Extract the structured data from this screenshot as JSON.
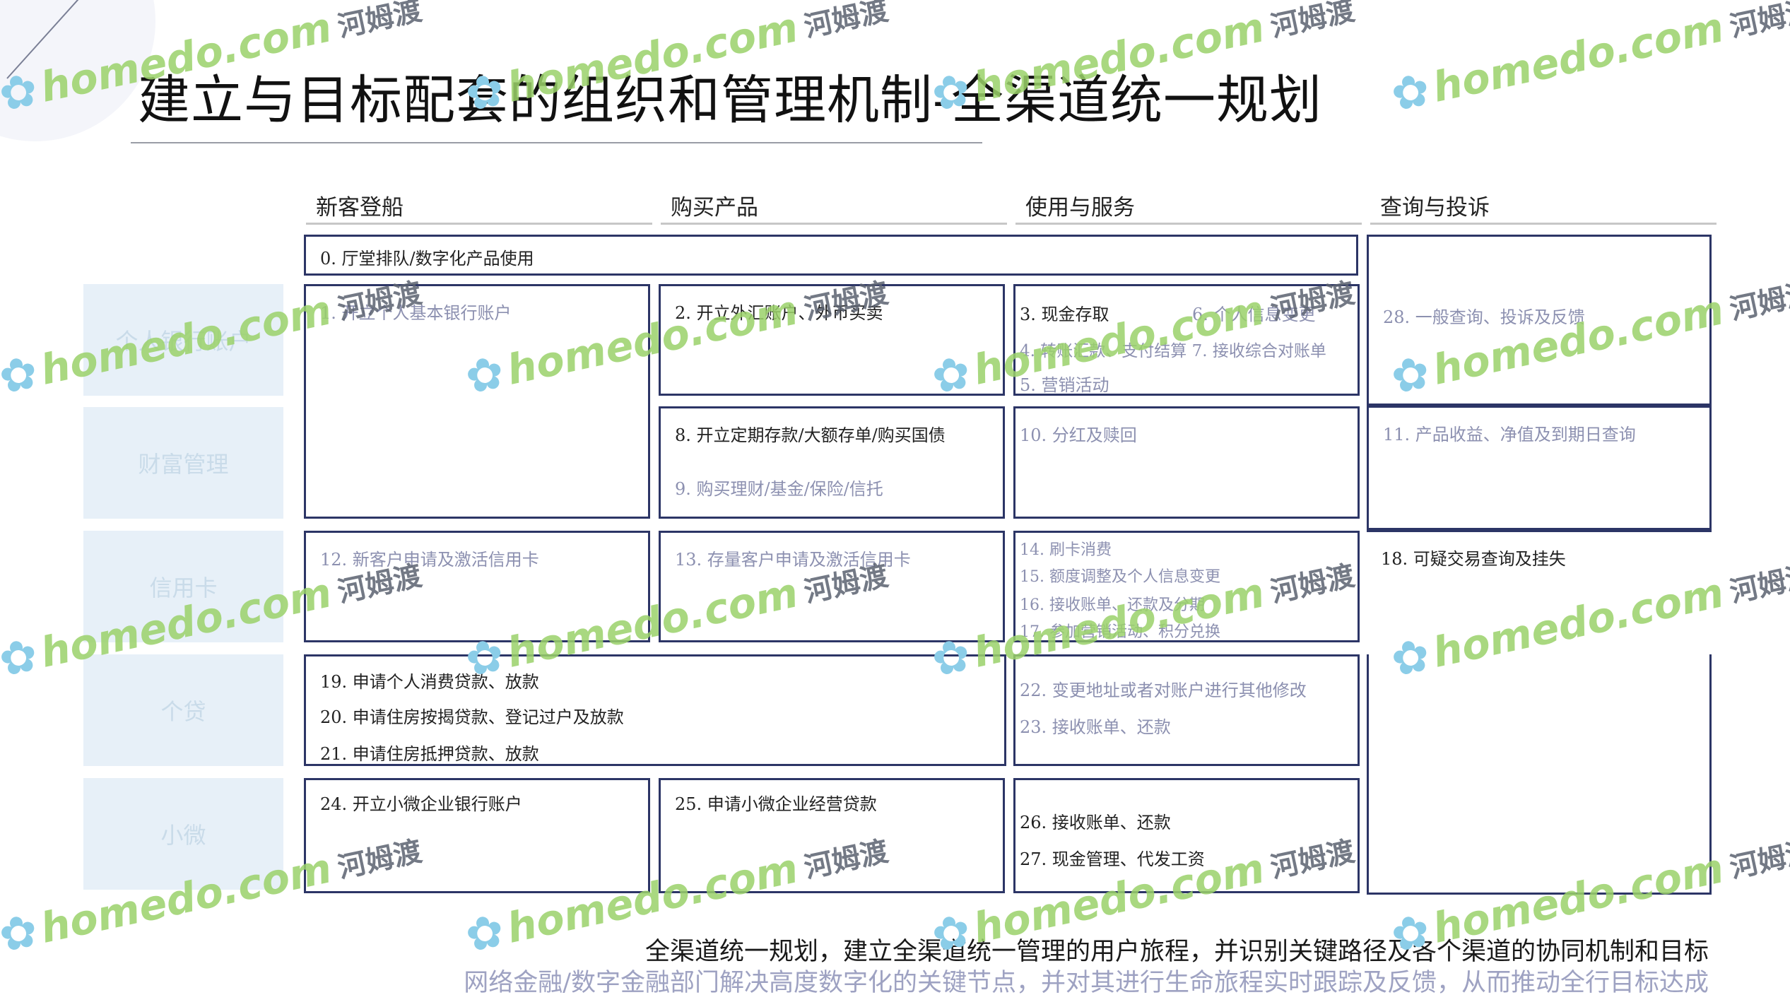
{
  "title": "建立与目标配套的组织和管理机制-全渠道统一规划",
  "columns": [
    "新客登船",
    "购买产品",
    "使用与服务",
    "查询与投诉"
  ],
  "rows": [
    "个人银行账户",
    "财富管理",
    "信用卡",
    "个贷",
    "小微"
  ],
  "cells": {
    "top_banner": "0. 厅堂排队/数字化产品使用",
    "c1": "1. 开立个人基本银行账户",
    "c2": "2. 开立外汇账户、外币买卖",
    "c3": [
      "3. 现金存取",
      "6. 个人信息变更",
      "4. 转账汇款、支付结算 7. 接收综合对账单",
      "5. 营销活动"
    ],
    "c28": "28. 一般查询、投诉及反馈",
    "c8": "8. 开立定期存款/大额存单/购买国债",
    "c9": "9. 购买理财/基金/保险/信托",
    "c10": "10. 分红及赎回",
    "c11": "11. 产品收益、净值及到期日查询",
    "c12": "12. 新客户申请及激活信用卡",
    "c13": "13. 存量客户申请及激活信用卡",
    "c14": [
      "14. 刷卡消费",
      "15. 额度调整及个人信息变更",
      "16. 接收账单、还款及分期",
      "17. 参加营销活动、积分兑换"
    ],
    "c18": "18. 可疑交易查询及挂失",
    "c19": [
      "19. 申请个人消费贷款、放款",
      "20. 申请住房按揭贷款、登记过户及放款",
      "21. 申请住房抵押贷款、放款"
    ],
    "c22": [
      "22. 变更地址或者对账户进行其他修改",
      "23. 接收账单、还款"
    ],
    "c24": "24. 开立小微企业银行账户",
    "c25": "25. 申请小微企业经营贷款",
    "c26": [
      "26. 接收账单、还款",
      "27. 现金管理、代发工资"
    ]
  },
  "footer": {
    "line1": "全渠道统一规划，建立全渠道统一管理的用户旅程，并识别关键路径及各个渠道的协同机制和目标",
    "line2": "网络金融/数字金融部门解决高度数字化的关键节点，并对其进行生命旅程实时跟踪及反馈，从而推动全行目标达成"
  },
  "watermark": {
    "brand": "homedo.com",
    "brand_cn": "河姆渡",
    "icon": "flower-icon"
  },
  "colors": {
    "box_border": "#2c3566",
    "row_label_bg": "#e7f0f8",
    "light_text": "#8c90b0",
    "watermark_green": "#9bd26a",
    "watermark_blue": "#8bcde8"
  }
}
